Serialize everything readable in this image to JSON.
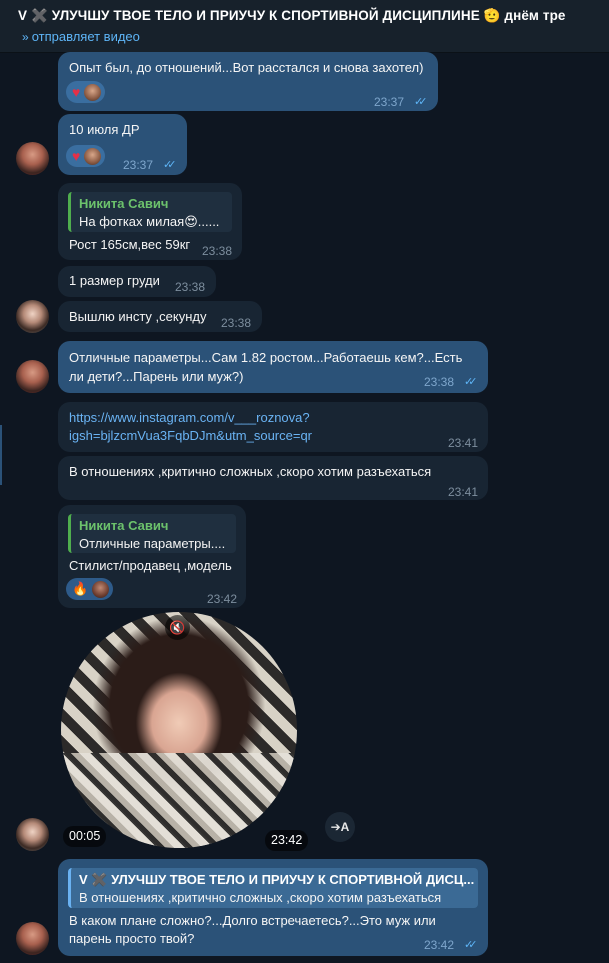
{
  "header": {
    "title": "V ✖️ УЛУЧШУ ТВОЕ ТЕЛО И ПРИУЧУ К СПОРТИВНОЙ ДИСЦИПЛИНЕ 🫡 днём тре",
    "status": "отправляет видео"
  },
  "messages": [
    {
      "text": "Опыт был, до отношений...Вот расстался и снова захотел)",
      "time": "23:37",
      "side": "out",
      "reactions": [
        "heart"
      ]
    },
    {
      "text": "10 июля ДР",
      "time": "23:37",
      "side": "out",
      "reactions": [
        "heart"
      ]
    },
    {
      "reply_name": "Никита Савич",
      "reply_text": "На фотках милая😍......",
      "text": "Рост 165см,вес 59кг",
      "time": "23:38",
      "side": "in"
    },
    {
      "text": "1 размер груди",
      "time": "23:38",
      "side": "in"
    },
    {
      "text": "Вышлю инсту ,секунду",
      "time": "23:38",
      "side": "in"
    },
    {
      "text_line1": "Отличные параметры...Сам 1.82 ростом...Работаешь кем?...Есть",
      "text_line2": "ли дети?...Парень или муж?)",
      "time": "23:38",
      "side": "out"
    },
    {
      "link_line1": "https://www.instagram.com/v___roznova?",
      "link_line2": "igsh=bjlzcmVua3FqbDJm&utm_source=qr",
      "time": "23:41",
      "side": "in"
    },
    {
      "text": "В отношениях ,критично сложных ,скоро хотим разъехаться",
      "time": "23:41",
      "side": "in"
    },
    {
      "reply_name": "Никита Савич",
      "reply_text": "Отличные параметры....",
      "text": "Стилист/продавец ,модель",
      "time": "23:42",
      "side": "in",
      "reactions": [
        "fire"
      ]
    },
    {
      "type": "video",
      "duration": "00:05",
      "time": "23:42",
      "translate_label": "➔A"
    },
    {
      "reply_name": "V ✖️ УЛУЧШУ ТВОЕ ТЕЛО И ПРИУЧУ К СПОРТИВНОЙ ДИСЦ...",
      "reply_text": "В отношениях ,критично сложных ,скоро хотим разъехаться",
      "text_line1": "В каком плане сложно?...Долго встречаетесь?...Это муж или",
      "text_line2": "парень просто твой?",
      "time": "23:42",
      "side": "out"
    }
  ],
  "colors": {
    "background": "#0e1621",
    "outgoing": "#2b5278",
    "incoming": "#182533",
    "accent": "#5eb5f7"
  },
  "icons": [
    "double-check-icon",
    "heart-reaction-icon",
    "fire-reaction-icon",
    "mute-icon",
    "translate-icon"
  ]
}
